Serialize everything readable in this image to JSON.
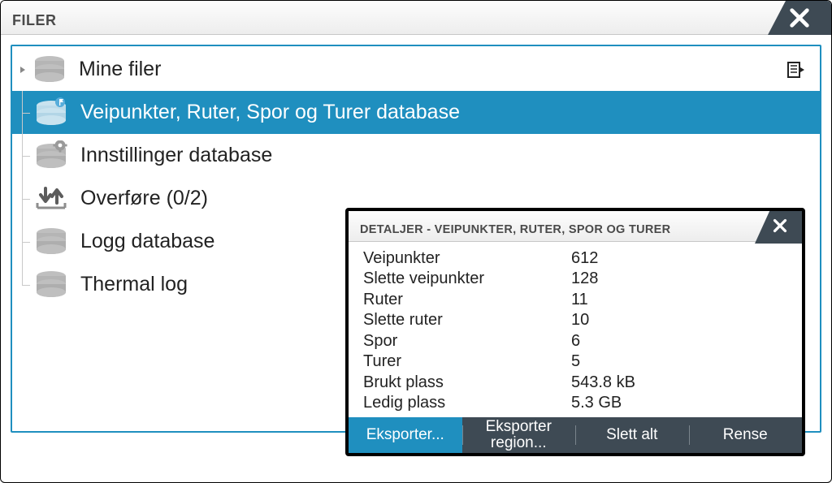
{
  "window": {
    "title": "FILER"
  },
  "list": {
    "items": [
      {
        "label": "Mine filer"
      },
      {
        "label": "Veipunkter, Ruter, Spor og Turer database"
      },
      {
        "label": "Innstillinger database"
      },
      {
        "label": "Overføre (0/2)"
      },
      {
        "label": "Logg database"
      },
      {
        "label": "Thermal log"
      }
    ]
  },
  "detail": {
    "title": "DETALJER - VEIPUNKTER, RUTER, SPOR OG TURER",
    "rows": [
      {
        "key": "Veipunkter",
        "value": "612"
      },
      {
        "key": "Slette veipunkter",
        "value": "128"
      },
      {
        "key": "Ruter",
        "value": "11"
      },
      {
        "key": "Slette ruter",
        "value": "10"
      },
      {
        "key": "Spor",
        "value": "6"
      },
      {
        "key": "Turer",
        "value": "5"
      },
      {
        "key": "Brukt plass",
        "value": "543.8 kB"
      },
      {
        "key": "Ledig plass",
        "value": "5.3 GB"
      }
    ],
    "buttons": {
      "export": "Eksporter...",
      "export_region_l1": "Eksporter",
      "export_region_l2": "region...",
      "delete_all": "Slett alt",
      "purge": "Rense"
    }
  }
}
